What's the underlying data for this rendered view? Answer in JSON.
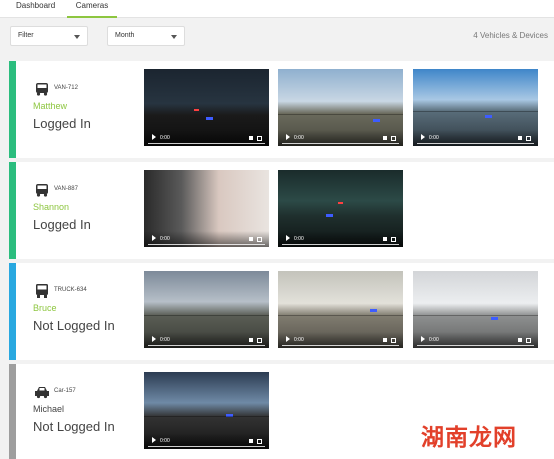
{
  "tabs": [
    {
      "label": "Dashboard",
      "active": false
    },
    {
      "label": "Cameras",
      "active": true
    }
  ],
  "filters": {
    "filter_label": "Filter",
    "month_label": "Month"
  },
  "summary": {
    "count_text": "4 Vehicles & Devices"
  },
  "colors": {
    "accent_green": "#8dc63f",
    "stripe_green": "#2bbd7e",
    "stripe_blue": "#29a8e0",
    "stripe_grey": "#9e9e9e",
    "driver_green": "#8dc63f",
    "driver_grey": "#444444"
  },
  "vehicles": [
    {
      "id": "VAN-712",
      "type_icon": "van-icon",
      "driver": "Matthew",
      "status": "Logged In",
      "stripe": "green",
      "videos": [
        {
          "time": "0:00",
          "scene": "night"
        },
        {
          "time": "0:00",
          "scene": "sunny"
        },
        {
          "time": "0:00",
          "scene": "road"
        }
      ]
    },
    {
      "id": "VAN-887",
      "type_icon": "van-icon",
      "driver": "Shannon",
      "status": "Logged In",
      "stripe": "green",
      "videos": [
        {
          "time": "0:00",
          "scene": "cabin"
        },
        {
          "time": "0:00",
          "scene": "tunnel"
        }
      ]
    },
    {
      "id": "TRUCK-634",
      "type_icon": "truck-icon",
      "driver": "Bruce",
      "status": "Not Logged In",
      "stripe": "blue",
      "videos": [
        {
          "time": "0:00",
          "scene": "cloudy"
        },
        {
          "time": "0:00",
          "scene": "hazy"
        },
        {
          "time": "0:00",
          "scene": "grey"
        }
      ]
    },
    {
      "id": "Car-157",
      "type_icon": "car-icon",
      "driver": "Michael",
      "status": "Not Logged In",
      "stripe": "grey",
      "videos": [
        {
          "time": "0:00",
          "scene": "dusk"
        }
      ]
    }
  ],
  "watermark": "湖南龙网"
}
